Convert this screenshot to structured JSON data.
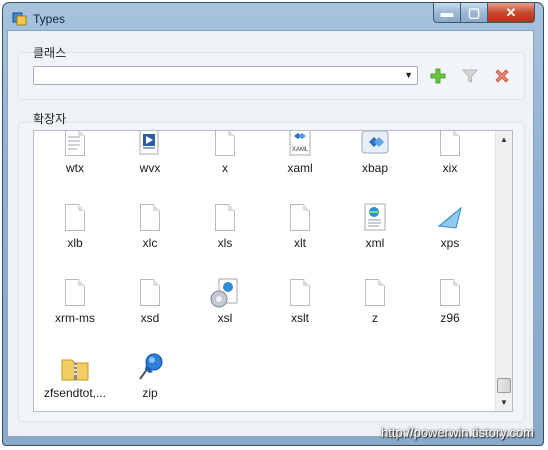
{
  "window": {
    "title": "Types"
  },
  "titlebar": {
    "min_glyph": "▬",
    "max_glyph": "▢",
    "close_glyph": "✕"
  },
  "class_group": {
    "label": "클래스",
    "combo_value": "",
    "add_icon": "plus-icon",
    "filter_icon": "filter-icon",
    "delete_icon": "delete-icon",
    "colors": {
      "add": "#5fbf3a",
      "filter": "#bdbdbd",
      "delete": "#e07a6a"
    }
  },
  "extension_group": {
    "label": "확장자",
    "items": [
      {
        "label": "wtx",
        "icon": "text-doc-icon"
      },
      {
        "label": "wvx",
        "icon": "media-playlist-icon"
      },
      {
        "label": "x",
        "icon": "blank-doc-icon"
      },
      {
        "label": "xaml",
        "icon": "xaml-icon"
      },
      {
        "label": "xbap",
        "icon": "xbap-icon"
      },
      {
        "label": "xix",
        "icon": "blank-doc-icon"
      },
      {
        "label": "xlb",
        "icon": "blank-doc-icon"
      },
      {
        "label": "xlc",
        "icon": "blank-doc-icon"
      },
      {
        "label": "xls",
        "icon": "blank-doc-icon"
      },
      {
        "label": "xlt",
        "icon": "blank-doc-icon"
      },
      {
        "label": "xml",
        "icon": "xml-icon"
      },
      {
        "label": "xps",
        "icon": "xps-icon"
      },
      {
        "label": "xrm-ms",
        "icon": "blank-doc-icon"
      },
      {
        "label": "xsd",
        "icon": "blank-doc-icon"
      },
      {
        "label": "xsl",
        "icon": "xsl-gear-icon"
      },
      {
        "label": "xslt",
        "icon": "blank-doc-icon"
      },
      {
        "label": "z",
        "icon": "blank-doc-icon"
      },
      {
        "label": "z96",
        "icon": "blank-doc-icon"
      },
      {
        "label": "zfsendtot,...",
        "icon": "zip-folder-icon"
      },
      {
        "label": "zip",
        "icon": "pushpin-icon"
      }
    ]
  },
  "watermark": "http://powerwin.tistory.com"
}
